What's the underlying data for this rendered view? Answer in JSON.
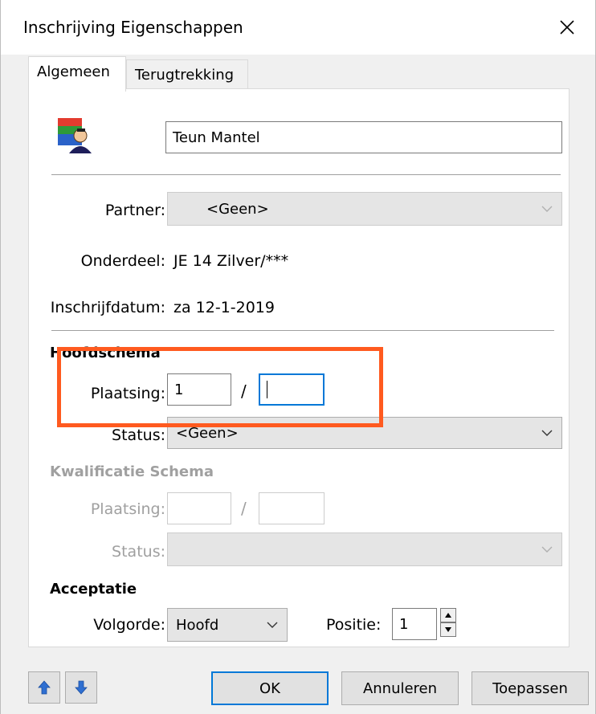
{
  "window": {
    "title": "Inschrijving Eigenschappen"
  },
  "tabs": [
    {
      "label": "Algemeen",
      "active": true
    },
    {
      "label": "Terugtrekking",
      "active": false
    }
  ],
  "general": {
    "name_value": "Teun Mantel",
    "partner_label": "Partner:",
    "partner_value": "<Geen>",
    "onderdeel_label": "Onderdeel:",
    "onderdeel_value": "JE 14 Zilver/***",
    "inschrijfdatum_label": "Inschrijfdatum:",
    "inschrijfdatum_value": "za 12-1-2019"
  },
  "hoofdschema": {
    "title": "Hoofdschema",
    "plaatsing_label": "Plaatsing:",
    "plaatsing_value": "1",
    "separator": "/",
    "plaatsing_total": "",
    "status_label": "Status:",
    "status_value": "<Geen>"
  },
  "kwalificatie": {
    "title": "Kwalificatie Schema",
    "plaatsing_label": "Plaatsing:",
    "plaatsing_value": "",
    "separator": "/",
    "plaatsing_total": "",
    "status_label": "Status:",
    "status_value": ""
  },
  "acceptatie": {
    "title": "Acceptatie",
    "volgorde_label": "Volgorde:",
    "volgorde_value": "Hoofd",
    "positie_label": "Positie:",
    "positie_value": "1"
  },
  "buttons": {
    "ok": "OK",
    "annuleren": "Annuleren",
    "toepassen": "Toepassen"
  },
  "colors": {
    "accent": "#0078d7",
    "highlight": "#ff5a1f"
  }
}
